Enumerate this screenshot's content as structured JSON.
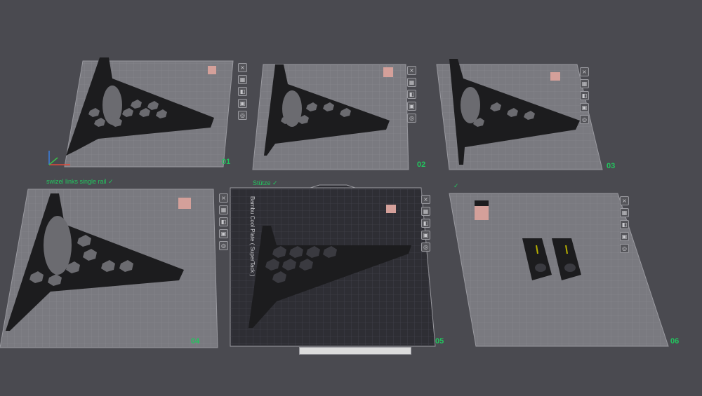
{
  "plates": [
    {
      "number": "01",
      "title": ""
    },
    {
      "number": "02",
      "title": ""
    },
    {
      "number": "03",
      "title": ""
    },
    {
      "number": "04",
      "title": "swizel links single rail ✓"
    },
    {
      "number": "05",
      "title": "Stütze ✓",
      "bed_label": "Bambu Cool Plate ( SuperTack )"
    },
    {
      "number": "06",
      "title": "✓"
    }
  ],
  "tool_icons": [
    "close-icon",
    "arrange-icon",
    "orient-icon",
    "lock-icon",
    "settings-icon"
  ],
  "colors": {
    "background": "#4a4a50",
    "plate": "#7a7a80",
    "part": "#1c1c1e",
    "accent_green": "#22c55e",
    "block": "#d4a09a"
  }
}
